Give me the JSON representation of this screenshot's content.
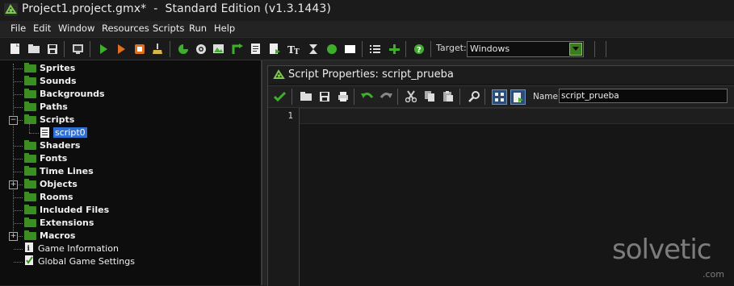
{
  "window": {
    "title": "Project1.project.gmx*  -  Standard Edition (v1.3.1443)"
  },
  "menu": [
    "File",
    "Edit",
    "Window",
    "Resources",
    "Scripts",
    "Run",
    "Help"
  ],
  "toolbar": {
    "target_label": "Target:",
    "target_value": "Windows"
  },
  "resource_tree": [
    {
      "label": "Sprites",
      "type": "folder"
    },
    {
      "label": "Sounds",
      "type": "folder"
    },
    {
      "label": "Backgrounds",
      "type": "folder"
    },
    {
      "label": "Paths",
      "type": "folder"
    },
    {
      "label": "Scripts",
      "type": "folder",
      "expanded": true
    },
    {
      "label": "script0",
      "type": "script",
      "selected": true
    },
    {
      "label": "Shaders",
      "type": "folder"
    },
    {
      "label": "Fonts",
      "type": "folder"
    },
    {
      "label": "Time Lines",
      "type": "folder"
    },
    {
      "label": "Objects",
      "type": "folder",
      "expandable": true
    },
    {
      "label": "Rooms",
      "type": "folder"
    },
    {
      "label": "Included Files",
      "type": "folder"
    },
    {
      "label": "Extensions",
      "type": "folder"
    },
    {
      "label": "Macros",
      "type": "folder",
      "expandable": true
    },
    {
      "label": "Game Information",
      "type": "info"
    },
    {
      "label": "Global Game Settings",
      "type": "settings"
    }
  ],
  "script_window": {
    "title": "Script Properties: script_prueba",
    "name_label": "Name:",
    "name_value": "script_prueba",
    "line_numbers": [
      "1"
    ]
  },
  "watermark": {
    "brand": "solvetic",
    "domain": ".com"
  },
  "colors": {
    "accent_green": "#3b8f22",
    "selection_blue": "#2e6fd6"
  }
}
